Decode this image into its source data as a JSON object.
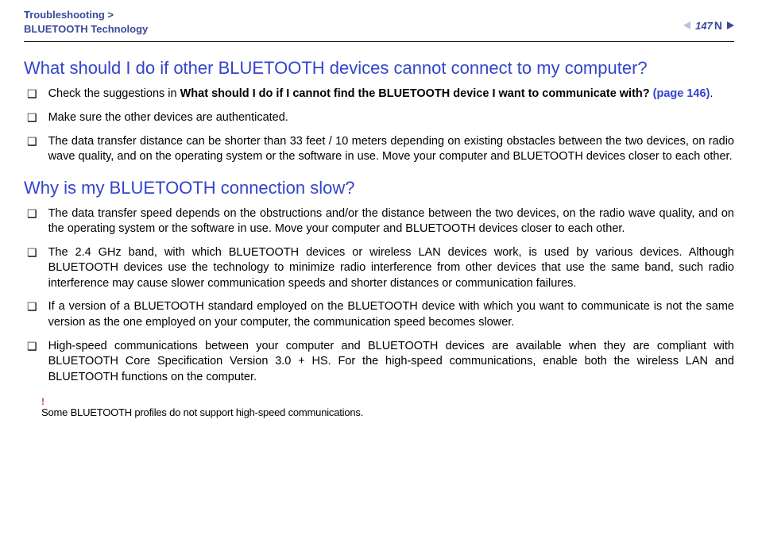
{
  "header": {
    "breadcrumb_line1": "Troubleshooting >",
    "breadcrumb_line2": "BLUETOOTH Technology",
    "page_number": "147"
  },
  "section1": {
    "heading": "What should I do if other BLUETOOTH devices cannot connect to my computer?",
    "items": [
      {
        "pre": "Check the suggestions in ",
        "bold": "What should I do if I cannot find the BLUETOOTH device I want to communicate with? ",
        "link": "(page 146)",
        "post": "."
      },
      {
        "text": "Make sure the other devices are authenticated."
      },
      {
        "text": "The data transfer distance can be shorter than 33 feet / 10 meters depending on existing obstacles between the two devices, on radio wave quality, and on the operating system or the software in use. Move your computer and BLUETOOTH devices closer to each other."
      }
    ]
  },
  "section2": {
    "heading": "Why is my BLUETOOTH connection slow?",
    "items": [
      {
        "text": "The data transfer speed depends on the obstructions and/or the distance between the two devices, on the radio wave quality, and on the operating system or the software in use. Move your computer and BLUETOOTH devices closer to each other."
      },
      {
        "text": "The 2.4 GHz band, with which BLUETOOTH devices or wireless LAN devices work, is used by various devices. Although BLUETOOTH devices use the technology to minimize radio interference from other devices that use the same band, such radio interference may cause slower communication speeds and shorter distances or communication failures."
      },
      {
        "text": "If a version of a BLUETOOTH standard employed on the BLUETOOTH device with which you want to communicate is not the same version as the one employed on your computer, the communication speed becomes slower."
      },
      {
        "text": "High-speed communications between your computer and BLUETOOTH devices are available when they are compliant with BLUETOOTH Core Specification Version 3.0 + HS. For the high-speed communications, enable both the wireless LAN and BLUETOOTH functions on the computer."
      }
    ],
    "note_mark": "!",
    "note_text": "Some BLUETOOTH profiles do not support high-speed communications."
  }
}
